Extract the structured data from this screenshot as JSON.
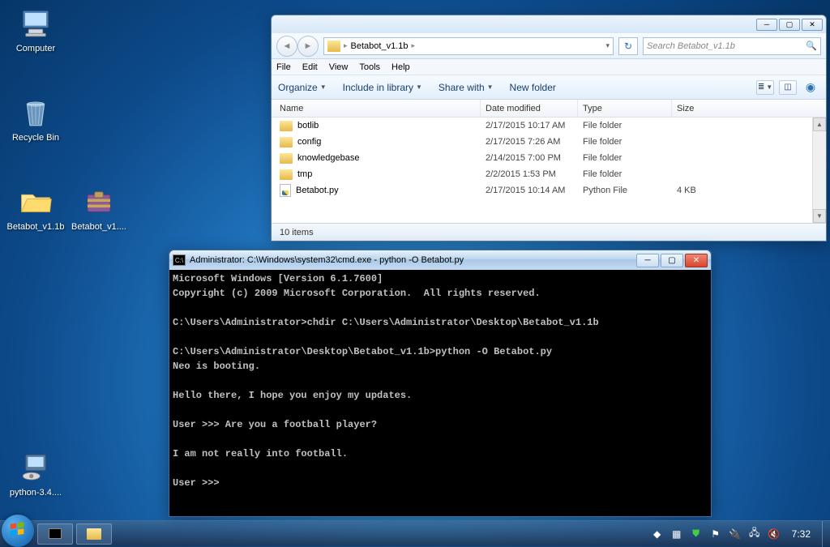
{
  "desktop": {
    "icons": [
      {
        "label": "Computer",
        "type": "computer"
      },
      {
        "label": "Recycle Bin",
        "type": "recycle"
      },
      {
        "label": "Betabot_v1.1b",
        "type": "folder"
      },
      {
        "label": "Betabot_v1....",
        "type": "winrar"
      },
      {
        "label": "python-3.4....",
        "type": "installer"
      }
    ]
  },
  "explorer": {
    "breadcrumb": "Betabot_v1.1b",
    "search_placeholder": "Search Betabot_v1.1b",
    "menu": {
      "file": "File",
      "edit": "Edit",
      "view": "View",
      "tools": "Tools",
      "help": "Help"
    },
    "toolbar": {
      "organize": "Organize",
      "include": "Include in library",
      "share": "Share with",
      "newfolder": "New folder"
    },
    "columns": {
      "name": "Name",
      "date": "Date modified",
      "type": "Type",
      "size": "Size"
    },
    "files": [
      {
        "name": "botlib",
        "date": "2/17/2015 10:17 AM",
        "type": "File folder",
        "size": "",
        "icon": "folder"
      },
      {
        "name": "config",
        "date": "2/17/2015 7:26 AM",
        "type": "File folder",
        "size": "",
        "icon": "folder"
      },
      {
        "name": "knowledgebase",
        "date": "2/14/2015 7:00 PM",
        "type": "File folder",
        "size": "",
        "icon": "folder"
      },
      {
        "name": "tmp",
        "date": "2/2/2015 1:53 PM",
        "type": "File folder",
        "size": "",
        "icon": "folder"
      },
      {
        "name": "Betabot.py",
        "date": "2/17/2015 10:14 AM",
        "type": "Python File",
        "size": "4 KB",
        "icon": "py"
      }
    ],
    "status": "10 items"
  },
  "cmd": {
    "title": "Administrator: C:\\Windows\\system32\\cmd.exe - python  -O Betabot.py",
    "body_lines": [
      "Microsoft Windows [Version 6.1.7600]",
      "Copyright (c) 2009 Microsoft Corporation.  All rights reserved.",
      "",
      "C:\\Users\\Administrator>chdir C:\\Users\\Administrator\\Desktop\\Betabot_v1.1b",
      "",
      "C:\\Users\\Administrator\\Desktop\\Betabot_v1.1b>python -O Betabot.py",
      "Neo is booting.",
      "",
      "Hello there, I hope you enjoy my updates.",
      "",
      "User >>> Are you a football player?",
      "",
      "I am not really into football.",
      "",
      "User >>> "
    ]
  },
  "taskbar": {
    "clock": "7:32"
  }
}
